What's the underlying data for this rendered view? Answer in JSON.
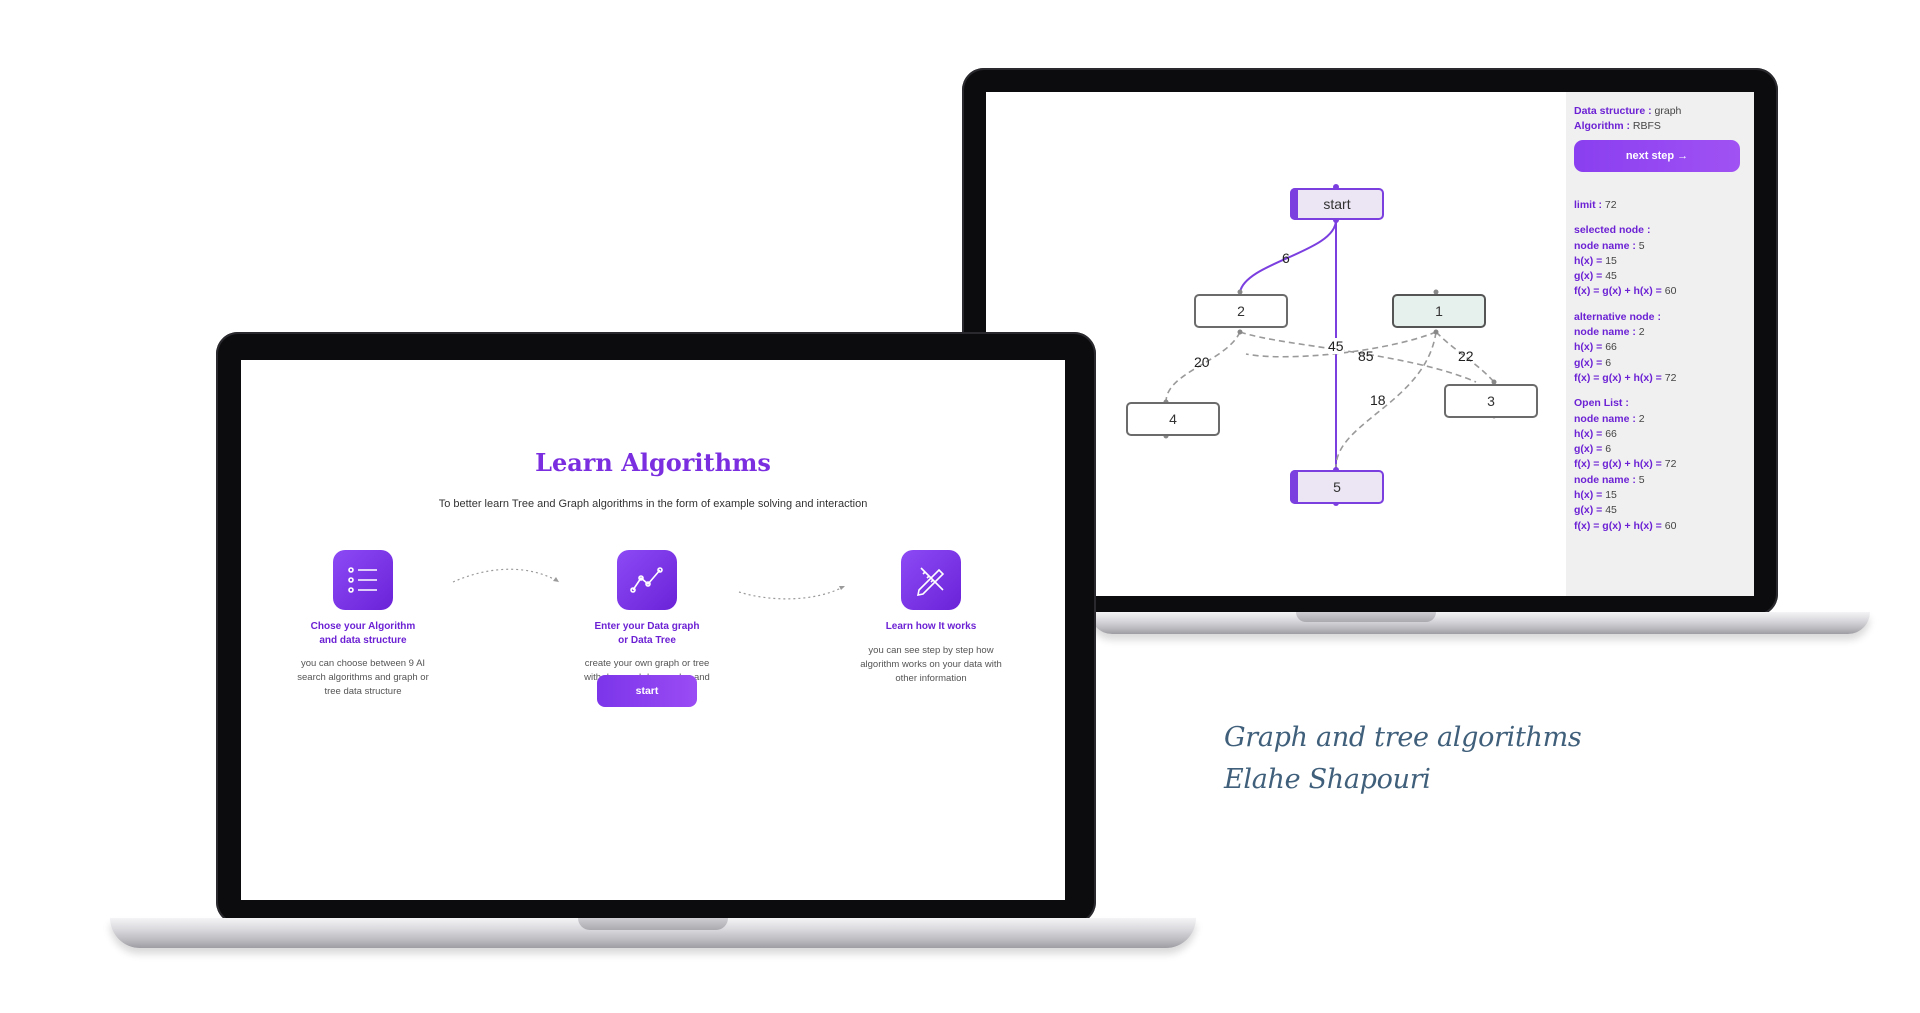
{
  "landing": {
    "title": "Learn Algorithms",
    "subtitle": "To better learn Tree and Graph algorithms in the form of example solving and interaction",
    "features": [
      {
        "icon": "list-icon",
        "title": "Chose your Algorithm and data structure",
        "desc": "you can choose between 9 AI search algorithms and graph or tree data structure"
      },
      {
        "icon": "chart-line-icon",
        "title": "Enter your Data graph or Data Tree",
        "desc": "create your own graph or tree with drag and drop nodes and paths"
      },
      {
        "icon": "pen-ruler-icon",
        "title": "Learn how It works",
        "desc": "you can see step by step how algorithm works on your data with other information"
      }
    ],
    "start_label": "start"
  },
  "graph_view": {
    "nodes": {
      "start": "start",
      "n2": "2",
      "n1": "1",
      "n4": "4",
      "n3": "3",
      "n5": "5"
    },
    "edge_labels": {
      "start_2": "6",
      "start_5": "45",
      "e85": "85",
      "e22": "22",
      "e20": "20",
      "e18": "18"
    },
    "panel": {
      "data_structure_label": "Data structure :",
      "data_structure_value": "graph",
      "algorithm_label": "Algorithm :",
      "algorithm_value": "RBFS",
      "next_step_label": "next step →",
      "limit_label": "limit :",
      "limit_value": "72",
      "selected_heading": "selected node :",
      "selected": {
        "name": "5",
        "h": "15",
        "g": "45",
        "f": "60"
      },
      "alternative_heading": "alternative node :",
      "alternative": {
        "name": "2",
        "h": "66",
        "g": "6",
        "f": "72"
      },
      "open_heading": "Open List :",
      "open_list": [
        {
          "name": "2",
          "h": "66",
          "g": "6",
          "f": "72"
        },
        {
          "name": "5",
          "h": "15",
          "g": "45",
          "f": "60"
        }
      ],
      "node_name_label": "node name :",
      "h_label": "h(x) =",
      "g_label": "g(x) =",
      "f_label": "f(x) = g(x) + h(x) ="
    }
  },
  "caption": {
    "line1": "Graph and tree algorithms",
    "line2": "Elahe Shapouri"
  },
  "colors": {
    "accent": "#7b3fe0",
    "caption": "#3f5f7a"
  }
}
